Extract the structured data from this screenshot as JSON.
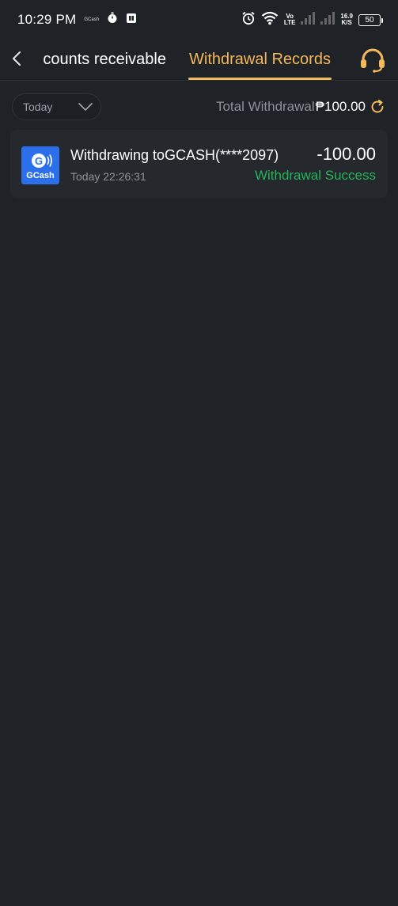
{
  "status_bar": {
    "time": "10:29 PM",
    "mini_label": "GCash",
    "volte_line1": "Vo",
    "volte_line2": "LTE",
    "speed_value": "16.9",
    "speed_unit": "K/S",
    "battery": "50"
  },
  "header": {
    "tabs": [
      {
        "label": "counts receivable",
        "active": false
      },
      {
        "label": "Withdrawal Records",
        "active": true
      }
    ],
    "accent_color": "#f5b85a"
  },
  "filter": {
    "date_value": "Today",
    "total_label": "Total Withdrawal",
    "total_amount": "₱100.00"
  },
  "records": [
    {
      "logo_text": "GCash",
      "title": "Withdrawing toGCASH(****2097)",
      "time": "Today 22:26:31",
      "amount": "-100.00",
      "status": "Withdrawal Success",
      "status_color": "#23b55b"
    }
  ],
  "icons": [
    "back-chevron-icon",
    "headset-icon",
    "chevron-down-icon",
    "refresh-icon",
    "gcash-logo"
  ]
}
